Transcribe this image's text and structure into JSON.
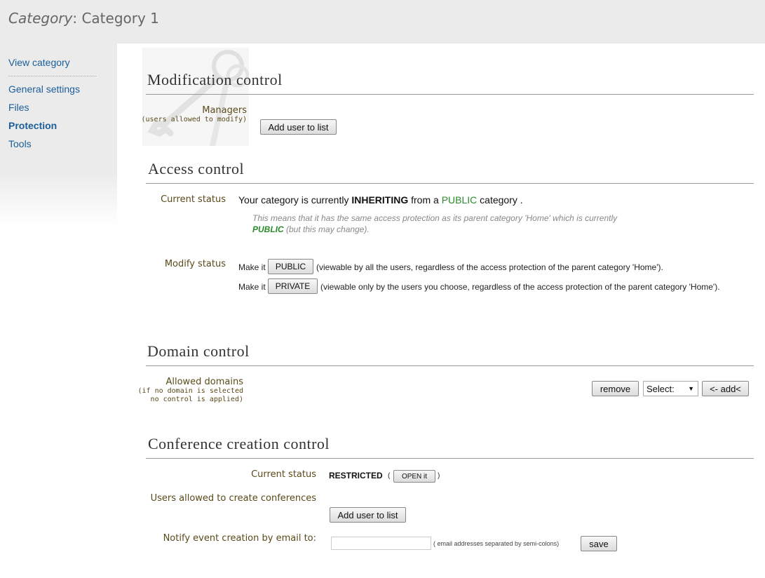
{
  "header": {
    "title_prefix": "Category",
    "title_rest": ": Category 1"
  },
  "sidebar": {
    "items": [
      {
        "label": "View category"
      },
      {
        "label": "General settings"
      },
      {
        "label": "Files"
      },
      {
        "label": "Protection"
      },
      {
        "label": "Tools"
      }
    ]
  },
  "modification": {
    "title": "Modification control",
    "managers_label": "Managers",
    "managers_sub": "(users allowed to modify)",
    "add_user_label": "Add user to list"
  },
  "access": {
    "title": "Access control",
    "current_status_label": "Current status",
    "status_text_1": "Your category is currently ",
    "status_inheriting": "INHERITING",
    "status_text_2": " from a ",
    "status_public": "PUBLIC",
    "status_text_3": " category .",
    "note_line1": "This means that it has the same access protection as its parent category 'Home' which is currently",
    "note_public": "PUBLIC",
    "note_line2_rest": " (but this may change).",
    "modify_status_label": "Modify status",
    "make_it": "Make it",
    "public_button": "PUBLIC",
    "public_desc": "(viewable by all the users, regardless of the access protection of the parent category 'Home').",
    "private_button": "PRIVATE",
    "private_desc": "(viewable only by the users you choose, regardless of the access protection of the parent category 'Home')."
  },
  "domain": {
    "title": "Domain control",
    "allowed_label": "Allowed domains",
    "allowed_sub1": "(if no domain is selected",
    "allowed_sub2": "no control is applied)",
    "remove_label": "remove",
    "select_value": "Select:",
    "add_label": "<- add<"
  },
  "conference": {
    "title": "Conference creation control",
    "current_status_label": "Current status",
    "status_value": "RESTRICTED",
    "paren_open": "(",
    "open_it_label": "OPEN it",
    "paren_close": ")",
    "users_allowed_label": "Users allowed to create conferences",
    "add_user_label": "Add user to list",
    "notify_label": "Notify event creation by email to:",
    "email_value": "",
    "email_hint": "( email addresses separated by semi-colons)",
    "save_label": "save"
  }
}
